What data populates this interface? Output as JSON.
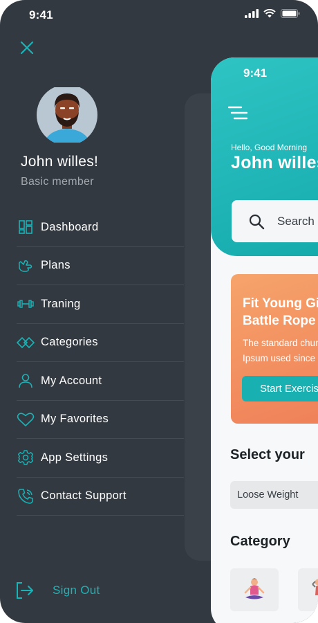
{
  "status_bar": {
    "time": "9:41"
  },
  "drawer": {
    "user": {
      "name": "John willes!",
      "membership": "Basic member"
    },
    "menu": [
      {
        "label": "Dashboard",
        "icon": "dashboard-icon"
      },
      {
        "label": "Plans",
        "icon": "plans-icon"
      },
      {
        "label": "Traning",
        "icon": "dumbbell-icon"
      },
      {
        "label": "Categories",
        "icon": "categories-icon"
      },
      {
        "label": "My Account",
        "icon": "user-icon"
      },
      {
        "label": "My Favorites",
        "icon": "heart-icon"
      },
      {
        "label": "App Settings",
        "icon": "gear-icon"
      },
      {
        "label": "Contact Support",
        "icon": "phone-icon"
      }
    ],
    "sign_out": "Sign Out"
  },
  "main": {
    "status_time": "9:41",
    "greeting": "Hello, Good Morning",
    "name": "John willes",
    "search_placeholder": "Search",
    "promo": {
      "title_line1": "Fit Young Girl",
      "title_line2": "Battle Rope",
      "desc_line1": "The standard chunk",
      "desc_line2": "Ipsum used since",
      "button": "Start Exercise"
    },
    "select_heading": "Select your",
    "goal_chip": "Loose Weight",
    "category_heading": "Category"
  },
  "colors": {
    "drawer_bg": "#333940",
    "accent": "#19b4b8",
    "promo": "#f28d5e"
  }
}
